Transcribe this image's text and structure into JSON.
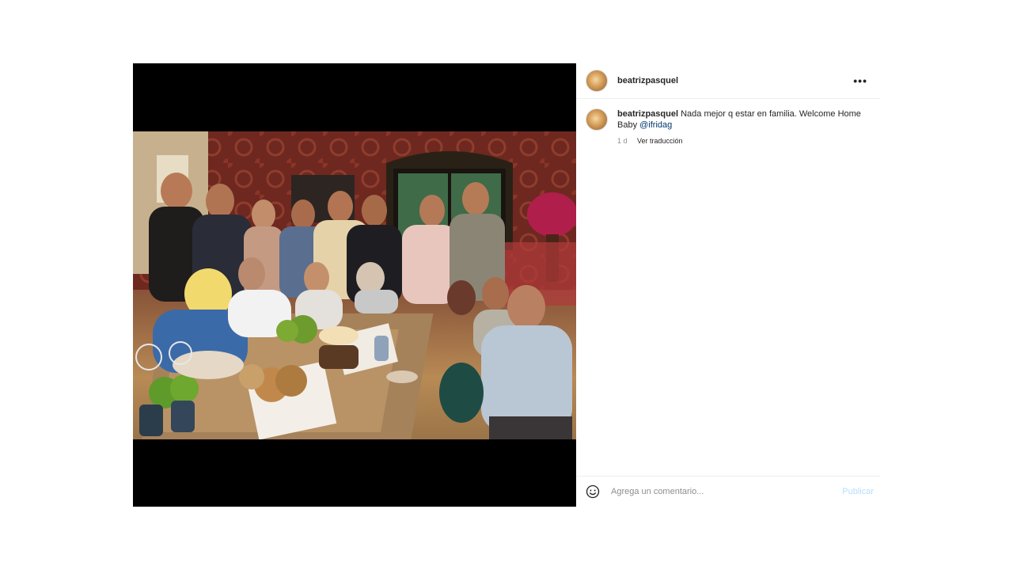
{
  "post": {
    "header": {
      "username": "beatrizpasquel",
      "more_label": "•••"
    },
    "caption": {
      "username": "beatrizpasquel",
      "text_before": " Nada mejor q estar en familia. Welcome Home Baby ",
      "mention": "@ifridag",
      "time": "1 d",
      "translate_label": "Ver traducción"
    },
    "comment_box": {
      "placeholder": "Agrega un comentario...",
      "publish_label": "Publicar"
    },
    "icons": {
      "options": "more-options-icon",
      "emoji": "emoji-icon"
    },
    "colors": {
      "link": "#00376b",
      "publish_disabled": "#b2dffc",
      "muted": "#8e8e8e"
    }
  }
}
